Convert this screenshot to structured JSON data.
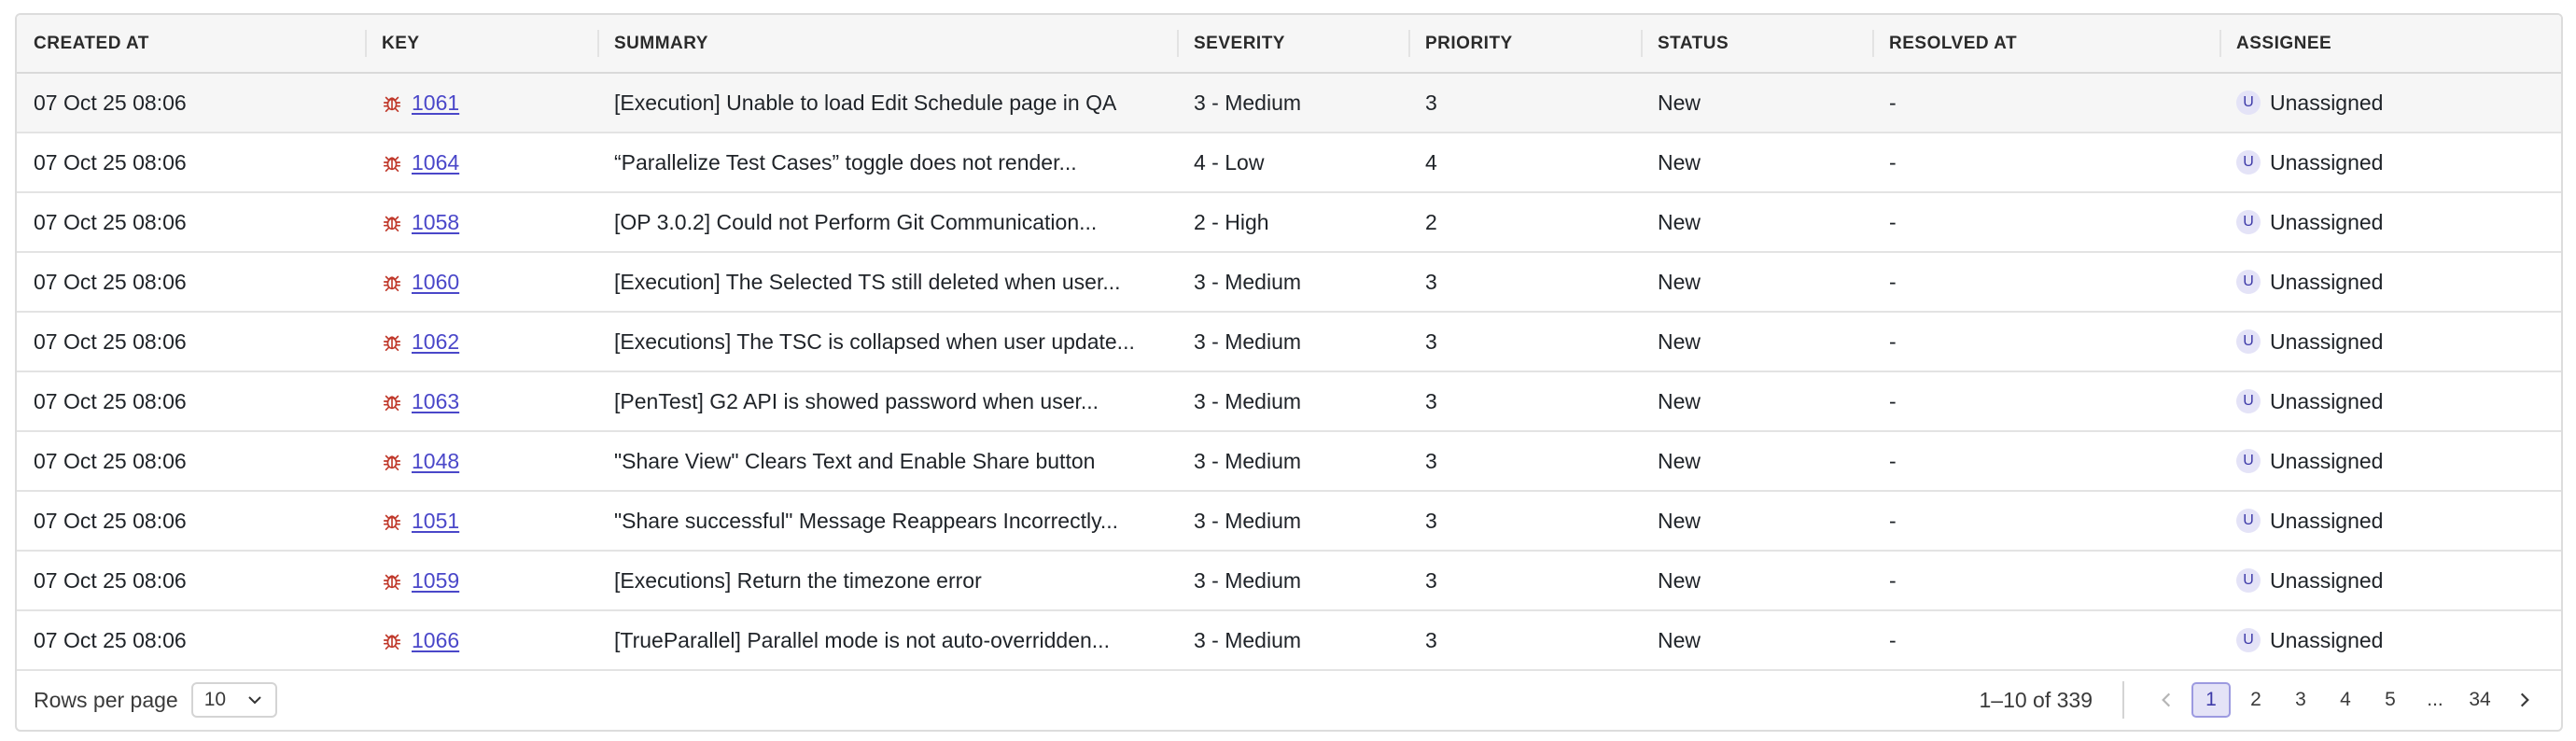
{
  "columns": [
    "Created At",
    "Key",
    "Summary",
    "Severity",
    "Priority",
    "Status",
    "Resolved At",
    "Assignee"
  ],
  "rows": [
    {
      "created_at": "07 Oct 25 08:06",
      "key": "1061",
      "summary": "[Execution] Unable to load Edit Schedule page in QA",
      "severity": "3 - Medium",
      "priority": "3",
      "status": "New",
      "resolved_at": "-",
      "avatar": "U",
      "assignee": "Unassigned"
    },
    {
      "created_at": "07 Oct 25 08:06",
      "key": "1064",
      "summary": "“Parallelize Test Cases” toggle does not render...",
      "severity": "4 - Low",
      "priority": "4",
      "status": "New",
      "resolved_at": "-",
      "avatar": "U",
      "assignee": "Unassigned"
    },
    {
      "created_at": "07 Oct 25 08:06",
      "key": "1058",
      "summary": "[OP 3.0.2] Could not Perform Git Communication...",
      "severity": "2 - High",
      "priority": "2",
      "status": "New",
      "resolved_at": "-",
      "avatar": "U",
      "assignee": "Unassigned"
    },
    {
      "created_at": "07 Oct 25 08:06",
      "key": "1060",
      "summary": "[Execution] The Selected TS still deleted when user...",
      "severity": "3 - Medium",
      "priority": "3",
      "status": "New",
      "resolved_at": "-",
      "avatar": "U",
      "assignee": "Unassigned"
    },
    {
      "created_at": "07 Oct 25 08:06",
      "key": "1062",
      "summary": "[Executions] The TSC is collapsed when user update...",
      "severity": "3 - Medium",
      "priority": "3",
      "status": "New",
      "resolved_at": "-",
      "avatar": "U",
      "assignee": "Unassigned"
    },
    {
      "created_at": "07 Oct 25 08:06",
      "key": "1063",
      "summary": "[PenTest] G2 API is showed password when user...",
      "severity": "3 - Medium",
      "priority": "3",
      "status": "New",
      "resolved_at": "-",
      "avatar": "U",
      "assignee": "Unassigned"
    },
    {
      "created_at": "07 Oct 25 08:06",
      "key": "1048",
      "summary": "\"Share View\" Clears Text and Enable Share button",
      "severity": "3 - Medium",
      "priority": "3",
      "status": "New",
      "resolved_at": "-",
      "avatar": "U",
      "assignee": "Unassigned"
    },
    {
      "created_at": "07 Oct 25 08:06",
      "key": "1051",
      "summary": "\"Share successful\" Message Reappears Incorrectly...",
      "severity": "3 - Medium",
      "priority": "3",
      "status": "New",
      "resolved_at": "-",
      "avatar": "U",
      "assignee": "Unassigned"
    },
    {
      "created_at": "07 Oct 25 08:06",
      "key": "1059",
      "summary": "[Executions] Return the timezone error",
      "severity": "3 - Medium",
      "priority": "3",
      "status": "New",
      "resolved_at": "-",
      "avatar": "U",
      "assignee": "Unassigned"
    },
    {
      "created_at": "07 Oct 25 08:06",
      "key": "1066",
      "summary": "[TrueParallel] Parallel mode is not auto-overridden...",
      "severity": "3 - Medium",
      "priority": "3",
      "status": "New",
      "resolved_at": "-",
      "avatar": "U",
      "assignee": "Unassigned"
    }
  ],
  "footer": {
    "rows_per_page_label": "Rows per page",
    "rows_per_page_value": "10",
    "range_text": "1–10 of 339",
    "pages": [
      "1",
      "2",
      "3",
      "4",
      "5",
      "...",
      "34"
    ],
    "active_page": "1"
  },
  "colors": {
    "accent": "#4a47c9",
    "bug_icon": "#c0392b",
    "avatar_bg": "#e4e3f7"
  },
  "icons": {
    "key": "bug-icon",
    "prev": "chevron-left-icon",
    "next": "chevron-right-icon",
    "select": "chevron-down-icon"
  }
}
